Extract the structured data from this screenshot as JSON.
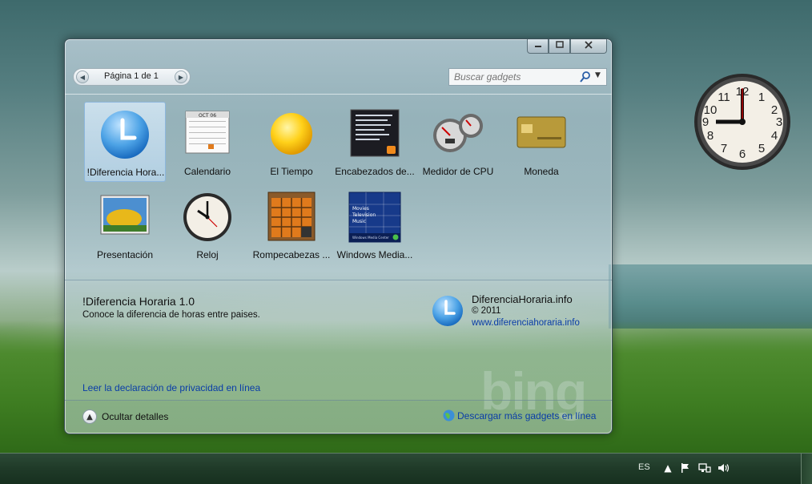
{
  "desktop": {
    "watermark": "bing"
  },
  "window": {
    "caption": {
      "minimize_icon": "minimize-icon",
      "maximize_icon": "maximize-icon",
      "close_icon": "close-icon"
    },
    "pager": {
      "text": "Página 1 de 1",
      "prev_icon": "chevron-left-icon",
      "next_icon": "chevron-right-icon"
    },
    "search": {
      "placeholder": "Buscar gadgets",
      "icon": "search-icon",
      "dropdown_icon": "chevron-down-icon"
    },
    "gadgets": [
      {
        "label": "!Diferencia Hora...",
        "icon": "clock-blue-icon",
        "selected": true
      },
      {
        "label": "Calendario",
        "icon": "calendar-icon",
        "month": "OCT 06"
      },
      {
        "label": "El Tiempo",
        "icon": "sun-icon"
      },
      {
        "label": "Encabezados de...",
        "icon": "rss-feed-icon"
      },
      {
        "label": "Medidor de CPU",
        "icon": "cpu-meter-icon"
      },
      {
        "label": "Moneda",
        "icon": "currency-card-icon"
      },
      {
        "label": "Presentación",
        "icon": "slideshow-icon"
      },
      {
        "label": "Reloj",
        "icon": "clock-icon"
      },
      {
        "label": "Rompecabezas ...",
        "icon": "puzzle-icon"
      },
      {
        "label": "Windows Media...",
        "icon": "media-center-icon",
        "menu": [
          "Movies",
          "Television",
          "Music"
        ],
        "brand": "Windows Media Center"
      }
    ],
    "details": {
      "title": "!Diferencia Horaria 1.0",
      "description": "Conoce la diferencia de horas entre paises.",
      "author": "DiferenciaHoraria.info",
      "copyright": "© 2011",
      "url": "www.diferenciahoraria.info",
      "privacy_link": "Leer la declaración de privacidad en línea"
    },
    "bottom": {
      "hide_details": "Ocultar detalles",
      "more_gadgets": "Descargar más gadgets en línea"
    }
  },
  "taskbar": {
    "language": "ES"
  },
  "colors": {
    "link": "#0a3da8",
    "selection": "#8db7de",
    "taskbar": "#1f3a28"
  }
}
